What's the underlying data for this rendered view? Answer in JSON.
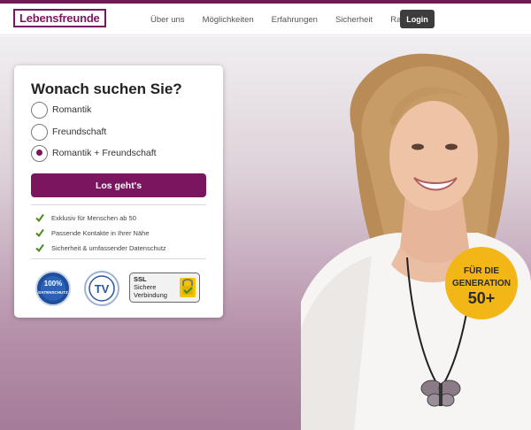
{
  "brand": {
    "logo": "Lebensfreunde",
    "accent": "#7b1560"
  },
  "nav": {
    "links": [
      "Über uns",
      "Möglichkeiten",
      "Erfahrungen",
      "Sicherheit",
      "Ratgeber"
    ],
    "login": "Login"
  },
  "search_card": {
    "title": "Wonach suchen Sie?",
    "options": [
      {
        "label": "Romantik",
        "selected": false
      },
      {
        "label": "Freundschaft",
        "selected": false
      },
      {
        "label": "Romantik + Freundschaft",
        "selected": true
      }
    ],
    "cta": "Los geht's",
    "features": [
      "Exklusiv für Menschen ab 50",
      "Passende Kontakte in Ihrer Nähe",
      "Sicherheit & umfassender Datenschutz"
    ],
    "badges": {
      "privacy": {
        "top": "100%",
        "bottom": "DATENSCHUTZ"
      },
      "tv": "TV",
      "ssl": {
        "line1": "SSL",
        "line2": "Sichere",
        "line3": "Verbindung"
      }
    }
  },
  "generation_badge": {
    "line1": "FÜR DIE",
    "line2": "GENERATION",
    "line3": "50+",
    "color": "#f2b617"
  }
}
